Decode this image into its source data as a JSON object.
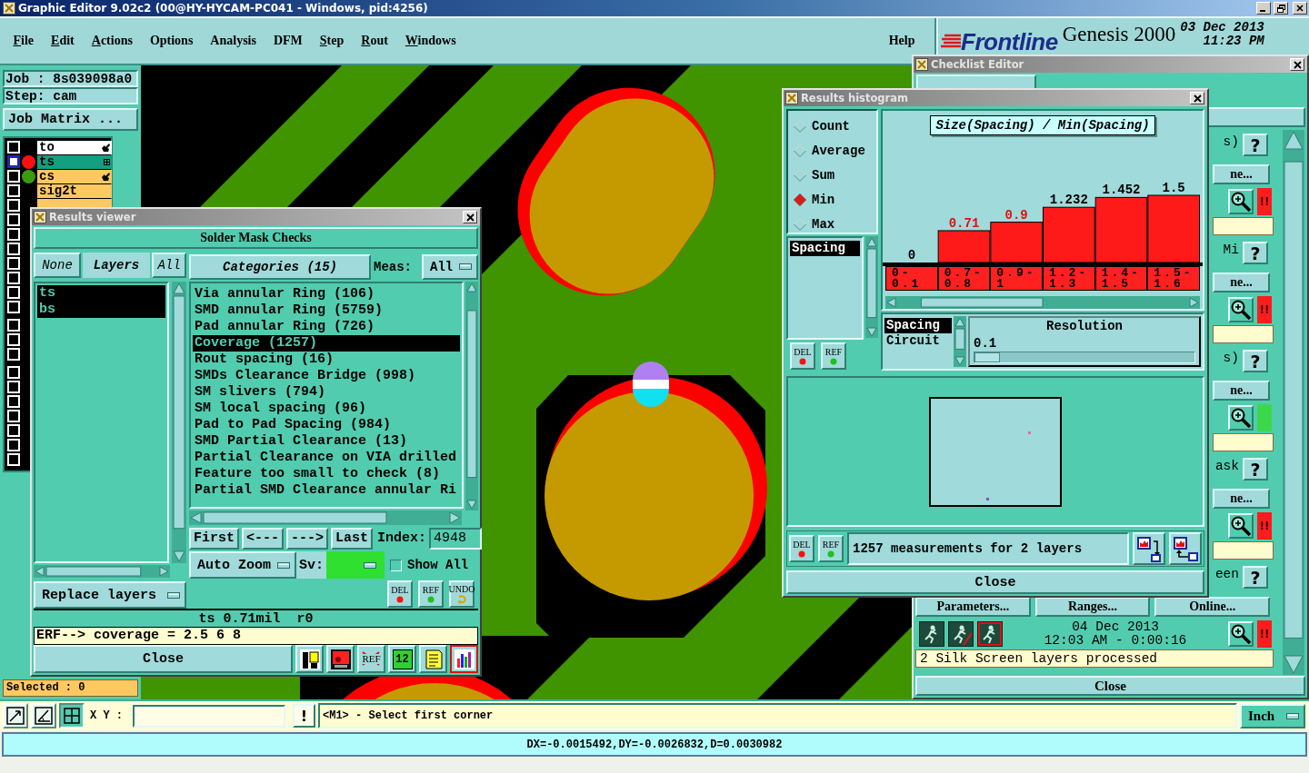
{
  "window": {
    "title": "Graphic Editor 9.02c2 (00@HY-HYCAM-PC041 - Windows, pid:4256)"
  },
  "menu": {
    "items": [
      {
        "label": "File",
        "mnemonic": true
      },
      {
        "label": "Edit",
        "mnemonic": true
      },
      {
        "label": "Actions",
        "mnemonic": true
      },
      {
        "label": "Options",
        "mnemonic": false
      },
      {
        "label": "Analysis",
        "mnemonic": false
      },
      {
        "label": "DFM",
        "mnemonic": false
      },
      {
        "label": "Step",
        "mnemonic": true
      },
      {
        "label": "Rout",
        "mnemonic": true
      },
      {
        "label": "Windows",
        "mnemonic": true
      }
    ],
    "help": "Help"
  },
  "header": {
    "brand": "Frontline",
    "product": "Genesis 2000",
    "date": "03 Dec 2013",
    "time": "11:23 PM"
  },
  "left_panel": {
    "job": "Job : 8s039098a0",
    "step": "Step: cam",
    "matrix_button": "Job Matrix ...",
    "layer_groups": [
      {
        "rows": [
          {
            "name": "to",
            "kind": "misc",
            "checked": false,
            "work": false,
            "affected": true
          },
          {
            "name": "ts",
            "kind": "board",
            "checked": false,
            "work": true,
            "affected": false,
            "color": "#ff1010"
          },
          {
            "name": "cs",
            "kind": "board",
            "checked": false,
            "work": false,
            "affected": true,
            "color": "#3c9a10"
          },
          {
            "name": "sig2t",
            "kind": "board",
            "checked": false,
            "work": false,
            "affected": false
          },
          {
            "kind": "board",
            "checked": false,
            "work": false,
            "affected": false
          },
          {
            "checked": false
          },
          {
            "checked": false
          },
          {
            "checked": false
          },
          {
            "checked": false
          },
          {
            "checked": false
          },
          {
            "checked": false
          },
          {
            "checked": false
          }
        ]
      },
      {
        "rows": [
          {
            "checked": false
          },
          {
            "checked": false
          },
          {
            "checked": false
          }
        ]
      },
      {
        "rows": [
          {
            "checked": false
          },
          {
            "checked": false
          },
          {
            "checked": false
          },
          {
            "checked": false
          },
          {
            "checked": false
          },
          {
            "checked": false
          },
          {
            "checked": false
          }
        ]
      }
    ],
    "selected": "Selected : 0"
  },
  "results_viewer": {
    "title": "Results viewer",
    "heading": "Solder Mask Checks",
    "none_button": "None",
    "layers_label": "Layers",
    "all_button": "All",
    "layers": [
      {
        "name": "ts",
        "selected": true
      },
      {
        "name": "bs",
        "selected": true
      }
    ],
    "replace_button": "Replace layers",
    "categories_button": "Categories (15)",
    "meas_label": "Meas:",
    "meas_value": "All",
    "categories": [
      {
        "label": "Via annular Ring (106)",
        "selected": false
      },
      {
        "label": "SMD annular Ring (5759)",
        "selected": false
      },
      {
        "label": "Pad annular Ring (726)",
        "selected": false
      },
      {
        "label": "Coverage (1257)",
        "selected": true
      },
      {
        "label": "Rout spacing (16)",
        "selected": false
      },
      {
        "label": "SMDs Clearance Bridge (998)",
        "selected": false
      },
      {
        "label": "SM slivers (794)",
        "selected": false
      },
      {
        "label": "SM local spacing (96)",
        "selected": false
      },
      {
        "label": "Pad to Pad Spacing (984)",
        "selected": false
      },
      {
        "label": "SMD Partial Clearance (13)",
        "selected": false
      },
      {
        "label": "Partial Clearance on VIA drilled",
        "selected": false
      },
      {
        "label": "Feature too small to check (8)",
        "selected": false
      },
      {
        "label": "Partial SMD Clearance annular Ri",
        "selected": false
      }
    ],
    "nav": [
      "First",
      "<---",
      "--->",
      "Last"
    ],
    "index_label": "Index:",
    "index_value": "4948",
    "zoom_mode": "Auto Zoom",
    "severity": {
      "label": "Sv:",
      "color": "#30e030"
    },
    "show_all": {
      "label": "Show All",
      "checked": false
    },
    "action_buttons": [
      {
        "kind": "delete",
        "text": "DEL"
      },
      {
        "kind": "reference",
        "text": "REF"
      },
      {
        "kind": "undo",
        "text": "UNDO"
      }
    ],
    "measurement": "ts 0.71mil  r0",
    "erf_line": "ERF--> coverage = 2.5 6 8",
    "close": "Close",
    "tools": [
      {
        "kind": "figure",
        "selected": false
      },
      {
        "kind": "screen",
        "selected": false
      },
      {
        "kind": "ref",
        "text": "REF",
        "selected": false
      },
      {
        "kind": "count",
        "text": "12",
        "selected": false
      },
      {
        "kind": "note",
        "selected": false
      },
      {
        "kind": "chart",
        "selected": true
      }
    ]
  },
  "histogram": {
    "title": "Results histogram",
    "modes": [
      {
        "label": "Count",
        "selected": false
      },
      {
        "label": "Average",
        "selected": false
      },
      {
        "label": "Sum",
        "selected": false
      },
      {
        "label": "Min",
        "selected": true
      },
      {
        "label": "Max",
        "selected": false
      }
    ],
    "measures": [
      {
        "label": "Spacing",
        "selected": true
      }
    ],
    "list_buttons": [
      {
        "kind": "delete",
        "text": "DEL"
      },
      {
        "kind": "reference",
        "text": "REF"
      }
    ],
    "chart_data": {
      "type": "bar",
      "title": "Size(Spacing) / Min(Spacing)",
      "categories": [
        "0-0.1",
        "0.7-0.8",
        "0.9-1",
        "1.2-1.3",
        "1.4-1.5",
        "1.5-1.6"
      ],
      "series": [
        {
          "color": "#ff1a1a",
          "values": [
            0,
            0.71,
            0.9,
            1.232,
            1.452,
            1.5
          ]
        }
      ],
      "data_labels": true
    },
    "flagged_values": [
      false,
      true,
      true,
      false,
      false,
      false
    ],
    "attributes": [
      {
        "label": "Spacing",
        "selected": true
      },
      {
        "label": "Circuit",
        "selected": false
      }
    ],
    "resolution": {
      "label": "Resolution",
      "value": "0.1",
      "level": 0
    },
    "summary_buttons": [
      {
        "kind": "delete",
        "text": "DEL"
      },
      {
        "kind": "reference",
        "text": "REF"
      }
    ],
    "summary": "1257 measurements for 2 layers",
    "view_tools": [
      {
        "kind": "down"
      },
      {
        "kind": "up"
      }
    ],
    "close": "Close"
  },
  "checklist": {
    "title": "Checklist Editor",
    "rows": [
      {
        "kind": "tail",
        "label": "s)",
        "help": "?",
        "action": "ne...",
        "flag": "!!",
        "color": "#ff1c1c"
      },
      {
        "kind": "tail",
        "label": "Mi",
        "help": "?",
        "action": "ne...",
        "flag": "!!",
        "color": "#ff1c1c"
      },
      {
        "kind": "tail",
        "label": "s)",
        "help": "?",
        "action": "ne...",
        "color": "#3cd84c"
      },
      {
        "kind": "tail",
        "label": "ask",
        "help": "?",
        "action": "ne...",
        "flag": "!!",
        "color": "#ff1c1c"
      },
      {
        "kind": "full",
        "label": "een",
        "help": "?",
        "buttons": [
          "Parameters...",
          "Ranges...",
          "Online..."
        ],
        "run_tools": [
          {
            "kind": "run"
          },
          {
            "kind": "run-marked"
          },
          {
            "kind": "run-framed"
          }
        ],
        "date": "04 Dec 2013",
        "time": "12:03 AM - 0:00:16",
        "flag": "!!",
        "color": "#ff1c1c",
        "message": "2 Silk Screen layers processed"
      }
    ],
    "close": "Close"
  },
  "command_bar": {
    "tools": [
      {
        "kind": "fit",
        "selected": false
      },
      {
        "kind": "angle",
        "selected": false
      },
      {
        "kind": "grid",
        "selected": true
      }
    ],
    "xy_label": "X Y :",
    "alert_button": "!",
    "prompt": "<M1> - Select first corner",
    "units": "Inch"
  },
  "status_bar": {
    "text": "DX=-0.0015492,DY=-0.0026832,D=0.0030982"
  }
}
